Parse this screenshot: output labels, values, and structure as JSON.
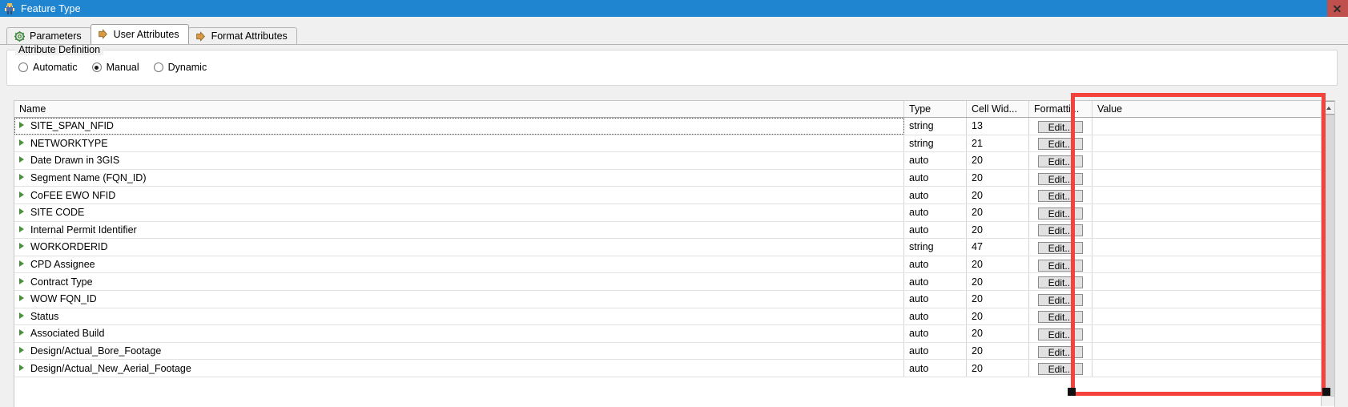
{
  "window": {
    "title": "Feature Type",
    "icon": "fme-workbench-icon",
    "close_label": "×",
    "titlebar_color": "#1f85d1",
    "close_button_color": "#c0504d"
  },
  "tabs": [
    {
      "label": "Parameters",
      "icon": "gear-icon",
      "active": false
    },
    {
      "label": "User Attributes",
      "icon": "arrow-right-icon",
      "active": true
    },
    {
      "label": "Format Attributes",
      "icon": "arrow-right-icon",
      "active": false
    }
  ],
  "attribute_definition": {
    "group_title": "Attribute Definition",
    "options": [
      {
        "label": "Automatic",
        "checked": false
      },
      {
        "label": "Manual",
        "checked": true
      },
      {
        "label": "Dynamic",
        "checked": false
      }
    ]
  },
  "table": {
    "columns": [
      {
        "key": "name",
        "label": "Name"
      },
      {
        "key": "type",
        "label": "Type"
      },
      {
        "key": "cell_width",
        "label": "Cell Wid..."
      },
      {
        "key": "formatting",
        "label": "Formatti..."
      },
      {
        "key": "value",
        "label": "Value"
      }
    ],
    "edit_button_label": "Edit...",
    "rows": [
      {
        "name": "SITE_SPAN_NFID",
        "type": "string",
        "cell_width": "13",
        "value": "",
        "selected": true
      },
      {
        "name": "NETWORKTYPE",
        "type": "string",
        "cell_width": "21",
        "value": "",
        "selected": false
      },
      {
        "name": "Date Drawn in 3GIS",
        "type": "auto",
        "cell_width": "20",
        "value": "",
        "selected": false
      },
      {
        "name": "Segment Name (FQN_ID)",
        "type": "auto",
        "cell_width": "20",
        "value": "",
        "selected": false
      },
      {
        "name": "CoFEE EWO NFID",
        "type": "auto",
        "cell_width": "20",
        "value": "",
        "selected": false
      },
      {
        "name": "SITE CODE",
        "type": "auto",
        "cell_width": "20",
        "value": "",
        "selected": false
      },
      {
        "name": "Internal Permit Identifier",
        "type": "auto",
        "cell_width": "20",
        "value": "",
        "selected": false
      },
      {
        "name": "WORKORDERID",
        "type": "string",
        "cell_width": "47",
        "value": "",
        "selected": false
      },
      {
        "name": "CPD Assignee",
        "type": "auto",
        "cell_width": "20",
        "value": "",
        "selected": false
      },
      {
        "name": "Contract Type",
        "type": "auto",
        "cell_width": "20",
        "value": "",
        "selected": false
      },
      {
        "name": "WOW FQN_ID",
        "type": "auto",
        "cell_width": "20",
        "value": "",
        "selected": false
      },
      {
        "name": "Status",
        "type": "auto",
        "cell_width": "20",
        "value": "",
        "selected": false
      },
      {
        "name": "Associated Build",
        "type": "auto",
        "cell_width": "20",
        "value": "",
        "selected": false
      },
      {
        "name": "Design/Actual_Bore_Footage",
        "type": "auto",
        "cell_width": "20",
        "value": "",
        "selected": false
      },
      {
        "name": "Design/Actual_New_Aerial_Footage",
        "type": "auto",
        "cell_width": "20",
        "value": "",
        "selected": false
      }
    ]
  },
  "annotation": {
    "shape": "rectangle",
    "color": "#f4433c",
    "target_column": "Value"
  },
  "scrollbar": {
    "orientation": "vertical",
    "up_arrow": "chevron-up-icon"
  }
}
